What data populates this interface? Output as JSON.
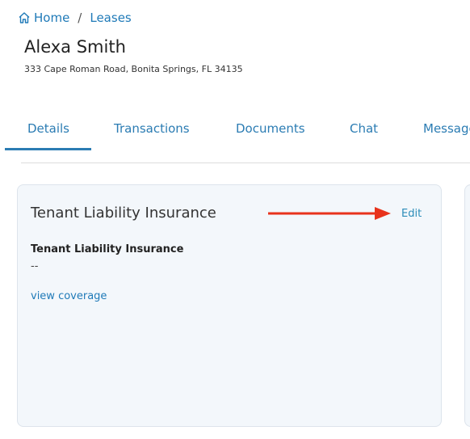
{
  "breadcrumb": {
    "home_label": "Home",
    "separator": "/",
    "leases_label": "Leases"
  },
  "tenant": {
    "name": "Alexa Smith",
    "address": "333 Cape Roman Road, Bonita Springs, FL 34135"
  },
  "tabs": [
    {
      "label": "Details",
      "active": true
    },
    {
      "label": "Transactions",
      "active": false
    },
    {
      "label": "Documents",
      "active": false
    },
    {
      "label": "Chat",
      "active": false
    },
    {
      "label": "Messages",
      "active": false
    }
  ],
  "insurance_card": {
    "title": "Tenant Liability Insurance",
    "edit_label": "Edit",
    "field_label": "Tenant Liability Insurance",
    "field_value": "--",
    "view_coverage_label": "view coverage"
  },
  "colors": {
    "link": "#1f7ab8",
    "tab_accent": "#2b7cb3",
    "card_bg": "#f3f7fb",
    "arrow": "#e8331c"
  },
  "icons": {
    "home": "home-icon",
    "annotation": "arrow-right-icon"
  }
}
